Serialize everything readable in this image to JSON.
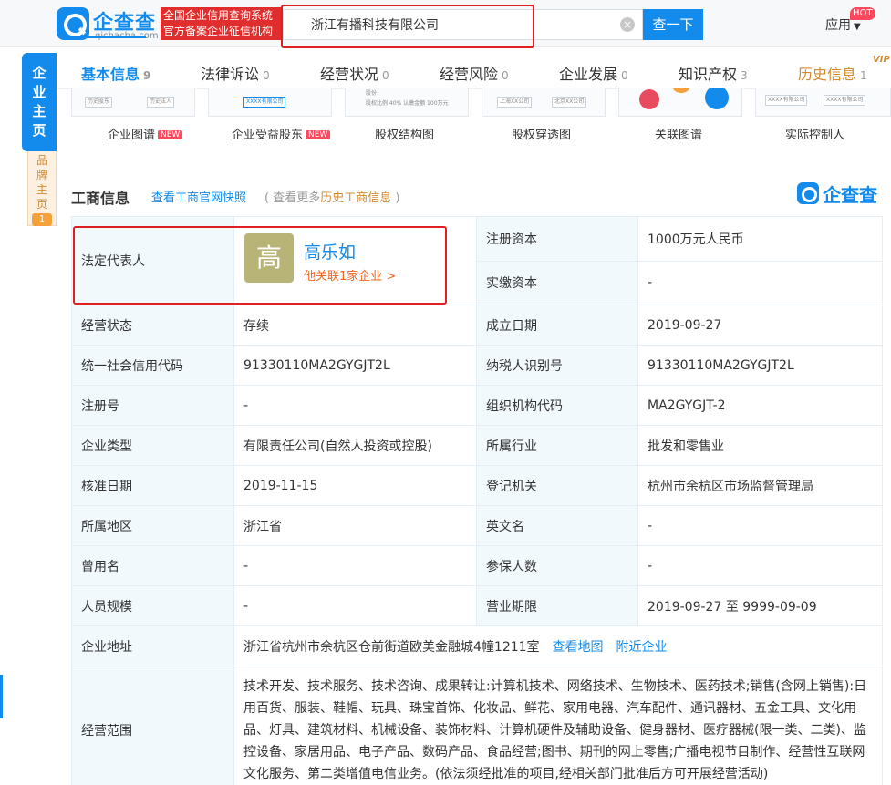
{
  "header": {
    "logo_text": "企查查",
    "logo_sub": "qichacha.com",
    "slogan_line1": "全国企业信用查询系统",
    "slogan_line2": "官方备案企业征信机构",
    "search_value": "浙江有播科技有限公司",
    "search_button": "查一下",
    "app_menu": "应用",
    "hot_badge": "HOT"
  },
  "sidebar": {
    "main_tab": [
      "企",
      "业",
      "主",
      "页"
    ],
    "brand_tab": [
      "品",
      "牌",
      "主",
      "页"
    ],
    "brand_count": "1"
  },
  "tabs": [
    {
      "label": "基本信息",
      "count": "9"
    },
    {
      "label": "法律诉讼",
      "count": "0"
    },
    {
      "label": "经营状况",
      "count": "0"
    },
    {
      "label": "经营风险",
      "count": "0"
    },
    {
      "label": "企业发展",
      "count": "0"
    },
    {
      "label": "知识产权",
      "count": "3"
    },
    {
      "label": "历史信息",
      "count": "1"
    }
  ],
  "vip_mark": "VIP",
  "graphs": [
    {
      "label": "企业图谱",
      "new": "NEW",
      "thumb": [
        "历史股东",
        "历史法人"
      ]
    },
    {
      "label": "企业受益股东",
      "new": "NEW",
      "thumb": [
        "XXXX有限公司"
      ]
    },
    {
      "label": "股权结构图",
      "new": "",
      "thumb": [
        "股份",
        "股权比例  40%  认缴金额  100万元"
      ]
    },
    {
      "label": "股权穿透图",
      "new": "",
      "thumb": [
        "上海XX公司",
        "北京XX公司"
      ]
    },
    {
      "label": "关联图谱",
      "new": "",
      "thumb": []
    },
    {
      "label": "实际控制人",
      "new": "",
      "thumb": [
        "XXXX有限公司",
        "XXXX有限公司"
      ]
    }
  ],
  "section": {
    "title": "工商信息",
    "snapshot_link": "查看工商官网快照",
    "note_prefix": "( 查看更多",
    "note_link": "历史工商信息",
    "note_suffix": ")",
    "watermark": "企查查"
  },
  "legal_rep": {
    "label": "法定代表人",
    "avatar_char": "高",
    "name": "高乐如",
    "associated": "他关联1家企业 >"
  },
  "rows_top": [
    {
      "label": "注册资本",
      "value": "1000万元人民币"
    },
    {
      "label": "实缴资本",
      "value": "-"
    }
  ],
  "rows": [
    {
      "l1": "经营状态",
      "v1": "存续",
      "l2": "成立日期",
      "v2": "2019-09-27"
    },
    {
      "l1": "统一社会信用代码",
      "v1": "91330110MA2GYGJT2L",
      "l2": "纳税人识别号",
      "v2": "91330110MA2GYGJT2L"
    },
    {
      "l1": "注册号",
      "v1": "-",
      "l2": "组织机构代码",
      "v2": "MA2GYGJT-2"
    },
    {
      "l1": "企业类型",
      "v1": "有限责任公司(自然人投资或控股)",
      "l2": "所属行业",
      "v2": "批发和零售业"
    },
    {
      "l1": "核准日期",
      "v1": "2019-11-15",
      "l2": "登记机关",
      "v2": "杭州市余杭区市场监督管理局"
    },
    {
      "l1": "所属地区",
      "v1": "浙江省",
      "l2": "英文名",
      "v2": "-"
    },
    {
      "l1": "曾用名",
      "v1": "-",
      "l2": "参保人数",
      "v2": "-"
    },
    {
      "l1": "人员规模",
      "v1": "-",
      "l2": "营业期限",
      "v2": "2019-09-27 至 9999-09-09"
    }
  ],
  "address": {
    "label": "企业地址",
    "value": "浙江省杭州市余杭区仓前街道欧美金融城4幢1211室",
    "map_link": "查看地图",
    "nearby_link": "附近企业"
  },
  "scope": {
    "label": "经营范围",
    "value": "技术开发、技术服务、技术咨询、成果转让:计算机技术、网络技术、生物技术、医药技术;销售(含网上销售):日用百货、服装、鞋帽、玩具、珠宝首饰、化妆品、鲜花、家用电器、汽车配件、通讯器材、五金工具、文化用品、灯具、建筑材料、机械设备、装饰材料、计算机硬件及辅助设备、健身器材、医疗器械(限一类、二类)、监控设备、家居用品、电子产品、数码产品、食品经营;图书、期刊的网上零售;广播电视节目制作、经营性互联网文化服务、第二类增值电信业务。(依法须经批准的项目,经相关部门批准后方可开展经营活动)"
  }
}
